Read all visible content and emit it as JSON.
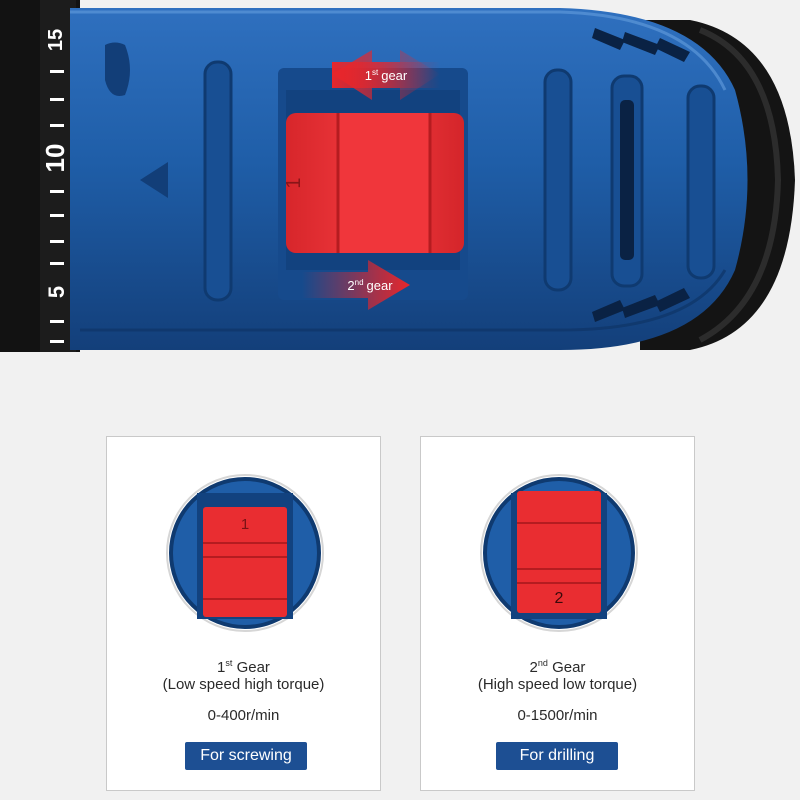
{
  "hero": {
    "dial_numbers": [
      "15",
      "10",
      "5"
    ],
    "switch_number": "1",
    "label_first": {
      "num": "1",
      "sup": "st",
      "word": "gear"
    },
    "label_second": {
      "num": "2",
      "sup": "nd",
      "word": "gear"
    }
  },
  "cards": [
    {
      "gear_num": "1",
      "gear_sup": "st",
      "gear_word": "Gear",
      "description": "(Low speed high torque)",
      "speed": "0-400r/min",
      "use": "For screwing",
      "switch_number": "1"
    },
    {
      "gear_num": "2",
      "gear_sup": "nd",
      "gear_word": "Gear",
      "description": "(High speed low torque)",
      "speed": "0-1500r/min",
      "use": "For drilling",
      "switch_number": "2"
    }
  ],
  "colors": {
    "body_blue": "#1f5ea8",
    "switch_red": "#ea2f34",
    "button_blue": "#1d4f93",
    "background": "#f1f1f1"
  }
}
